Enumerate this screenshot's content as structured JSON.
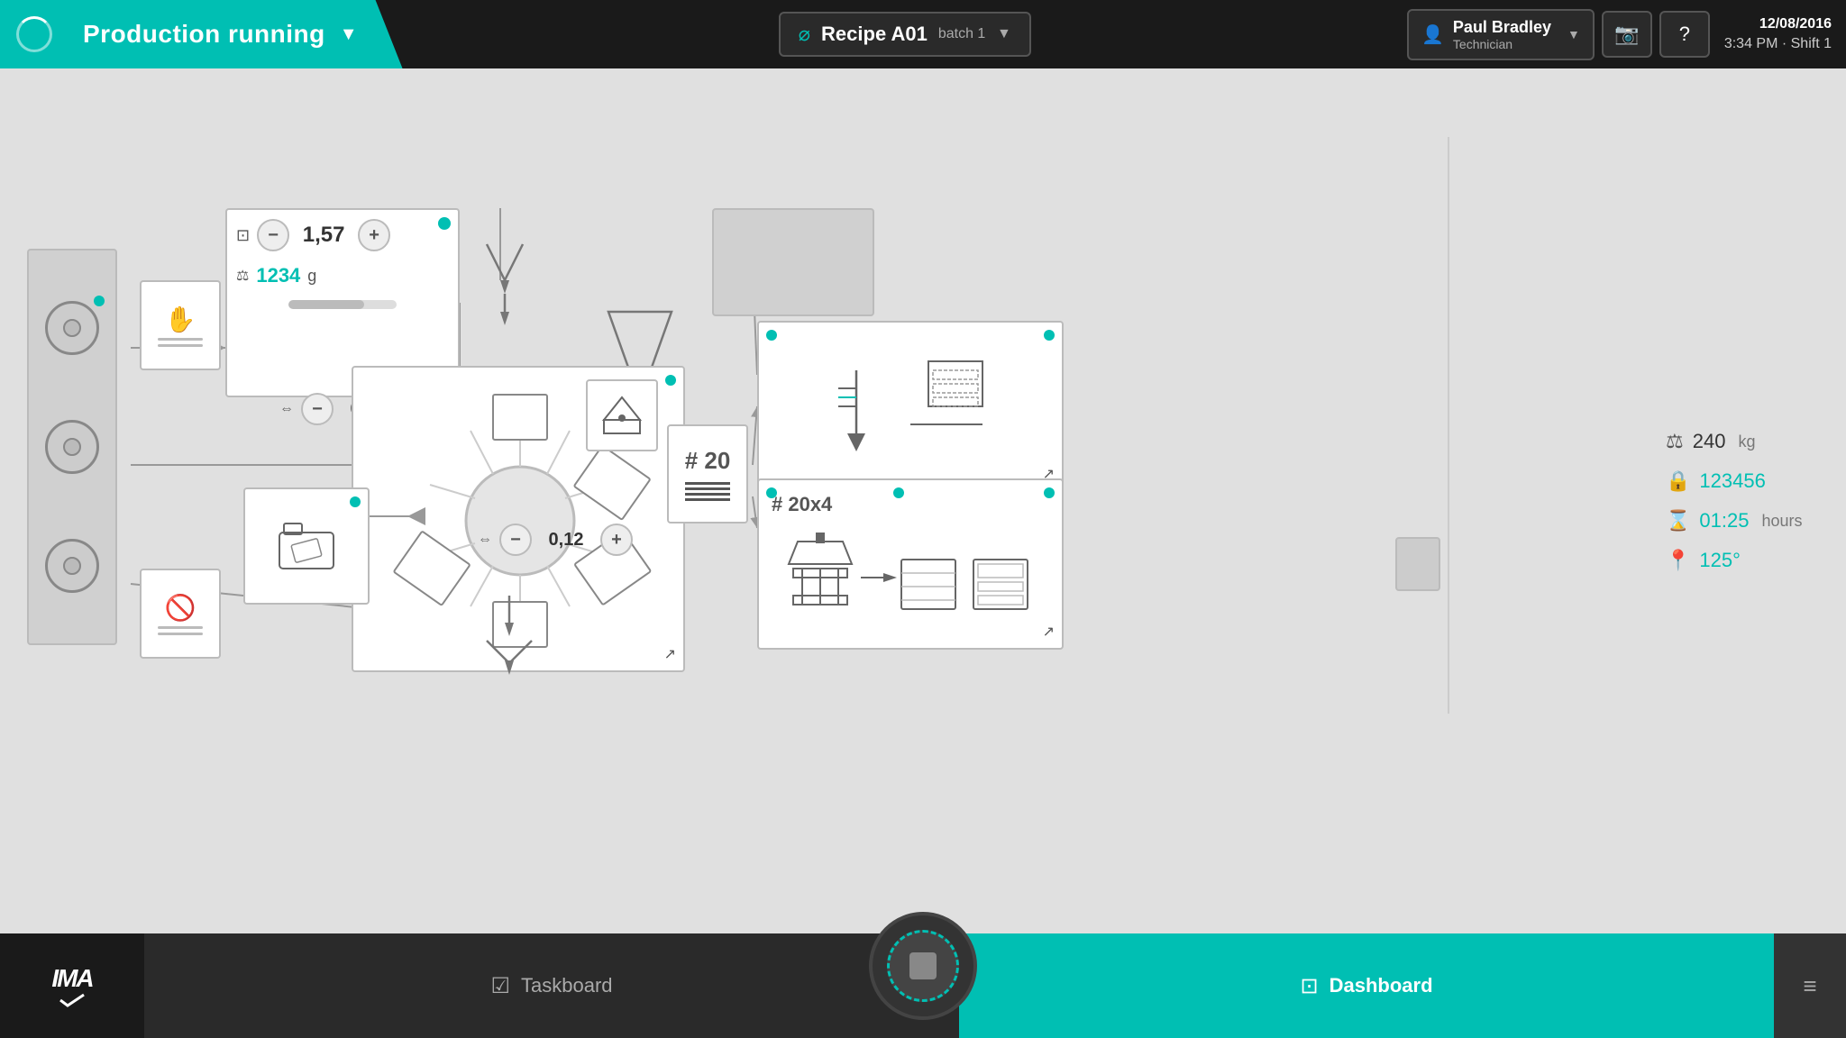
{
  "header": {
    "logo_label": "⊙",
    "title": "Production running",
    "dropdown_arrow": "▼",
    "recipe_icon": "⌀",
    "recipe_name": "Recipe A01",
    "recipe_batch": "batch 1",
    "recipe_arrow": "▼",
    "user_icon": "👤",
    "user_name": "Paul Bradley",
    "user_role": "Technician",
    "user_arrow": "▼",
    "camera_icon": "📷",
    "help_icon": "?",
    "date": "12/08/2016",
    "time": "3:34 PM · Shift 1"
  },
  "diagram": {
    "feeder": {
      "value": "1,57",
      "weight_value": "1234",
      "weight_unit": "g"
    },
    "speed": {
      "value": "0,12"
    },
    "speed2": {
      "value": "0,12"
    },
    "counter": {
      "label": "# 20"
    },
    "counter2": {
      "label": "# 20x4"
    }
  },
  "stats": {
    "weight_icon": "⚖",
    "weight_value": "240",
    "weight_unit": "kg",
    "lock_icon": "🔒",
    "lock_value": "123456",
    "timer_icon": "⌛",
    "timer_value": "01:25",
    "timer_unit": "hours",
    "location_icon": "📍",
    "location_value": "125°"
  },
  "footer": {
    "ima_logo": "IMA✓",
    "taskboard_icon": "☑",
    "taskboard_label": "Taskboard",
    "dashboard_icon": "⊡",
    "dashboard_label": "Dashboard",
    "menu_icon": "≡"
  }
}
